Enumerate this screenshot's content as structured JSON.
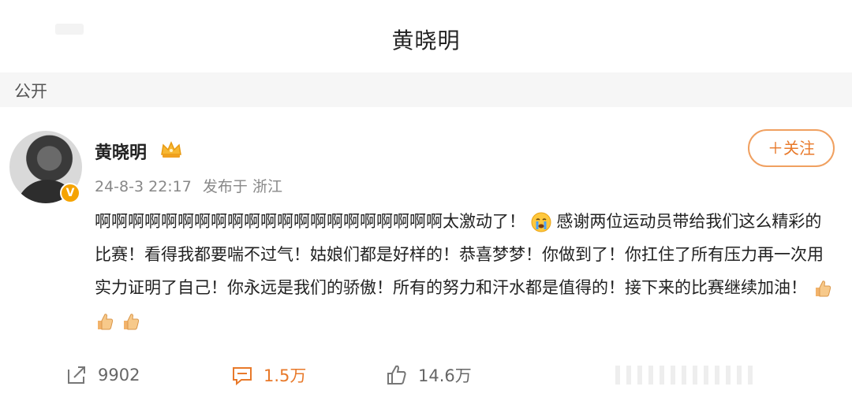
{
  "header": {
    "title": "黄晓明"
  },
  "visibility": {
    "label": "公开"
  },
  "post": {
    "author": "黄晓明",
    "date": "24-8-3 22:17",
    "source": "发布于 浙江",
    "follow_label": "＋关注",
    "verified_mark": "V",
    "text_part1": "啊啊啊啊啊啊啊啊啊啊啊啊啊啊啊啊啊啊啊啊啊太激动了！",
    "text_part2": "感谢两位运动员带给我们这么精彩的比赛！看得我都要喘不过气！姑娘们都是好样的！恭喜梦梦！你做到了！你扛住了所有压力再一次用实力证明了自己！你永远是我们的骄傲！所有的努力和汗水都是值得的！接下来的比赛继续加油！",
    "emojis": [
      "crying-face",
      "thumbs-up",
      "thumbs-up",
      "thumbs-up"
    ]
  },
  "actions": {
    "share_count": "9902",
    "comment_count": "1.5万",
    "like_count": "14.6万"
  },
  "colors": {
    "accent": "#e8792a",
    "badge": "#f5a300",
    "meta": "#888888"
  }
}
